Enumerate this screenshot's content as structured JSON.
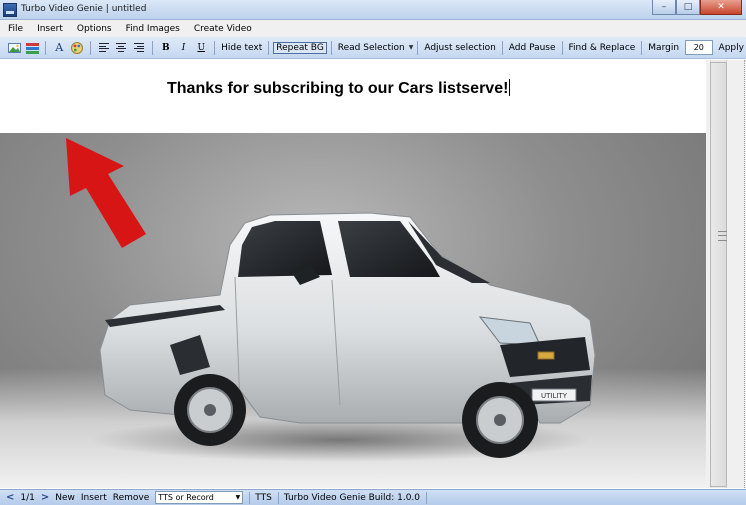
{
  "window": {
    "title": "Turbo Video Genie | untitled",
    "minimize": "–",
    "maximize": "□",
    "close": "✕"
  },
  "menu": {
    "items": [
      "File",
      "Insert",
      "Options",
      "Find Images",
      "Create Video"
    ]
  },
  "toolbar": {
    "font_glyph": "A",
    "bold": "B",
    "italic": "I",
    "underline": "U",
    "hide_text": "Hide text",
    "repeat_bg": "Repeat BG",
    "read_selection": "Read Selection",
    "adjust_selection": "Adjust selection",
    "add_pause": "Add Pause",
    "find_replace": "Find & Replace",
    "margin_label": "Margin",
    "margin_value": "20",
    "apply": "Apply"
  },
  "editor": {
    "headline": "Thanks for subscribing to our Cars listserve!",
    "badge_text": "UTILITY"
  },
  "statusbar": {
    "prev": "<",
    "page": "1/1",
    "next": ">",
    "new": "New",
    "insert": "Insert",
    "remove": "Remove",
    "tts_mode": "TTS or Record",
    "tts": "TTS",
    "build": "Turbo Video Genie Build: 1.0.0"
  },
  "colors": {
    "arrow": "#d81515",
    "toolbar_bg": "#cfdff3",
    "car_body": "#e4e6e7"
  },
  "icons": {
    "app": "app-icon",
    "image": "insert-image-icon",
    "colors": "color-bars-icon",
    "palette": "color-palette-icon"
  }
}
